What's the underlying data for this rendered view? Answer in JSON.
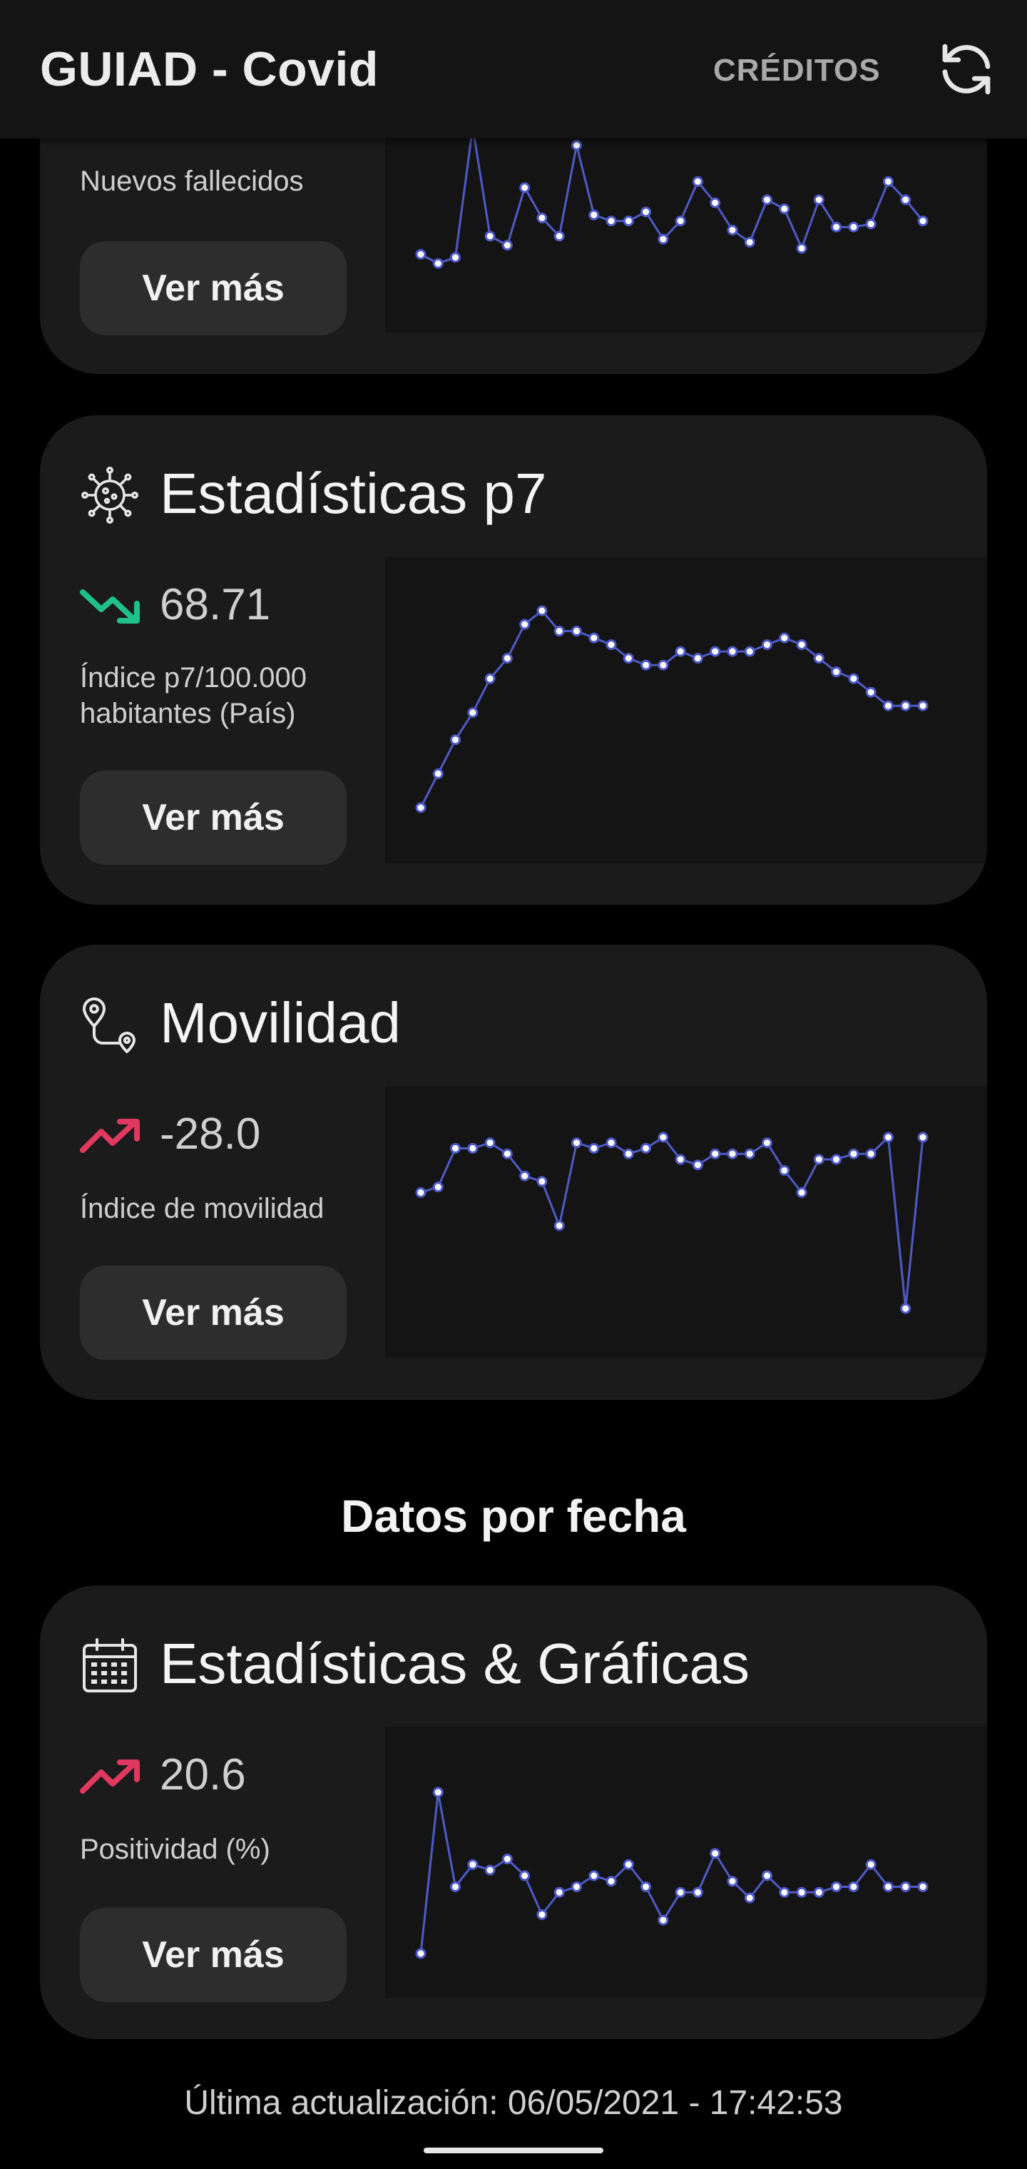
{
  "app_bar": {
    "title": "GUIAD - Covid",
    "credits_label": "CRÉDITOS",
    "refresh_icon": "refresh-icon"
  },
  "colors": {
    "line": "#4e5ac8",
    "point_fill": "#ffffff",
    "trend_down": "#1fc08a",
    "trend_up": "#e0385e"
  },
  "cards": [
    {
      "id": "fallecidos",
      "description": "Nuevos fallecidos",
      "button_label": "Ver más",
      "chart_data": {
        "type": "line",
        "values": [
          6,
          3,
          5,
          48,
          12,
          9,
          28,
          18,
          12,
          42,
          19,
          17,
          17,
          20,
          11,
          17,
          30,
          23,
          14,
          10,
          24,
          21,
          8,
          24,
          15,
          15,
          16,
          30,
          24,
          17
        ],
        "ylim": [
          0,
          48
        ]
      }
    },
    {
      "id": "p7",
      "title": "Estadísticas p7",
      "icon": "virus-icon",
      "trend": "down",
      "value": "68.71",
      "description_line1": "Índice p7/100.000",
      "description_line2": "habitantes (País)",
      "button_label": "Ver más",
      "chart_data": {
        "type": "line",
        "values": [
          48,
          53,
          58,
          62,
          67,
          70,
          75,
          77,
          74,
          74,
          73,
          72,
          70,
          69,
          69,
          71,
          70,
          71,
          71,
          71,
          72,
          73,
          72,
          70,
          68,
          67,
          65,
          63,
          63,
          63
        ],
        "ylim": [
          48,
          77
        ]
      }
    },
    {
      "id": "movilidad",
      "title": "Movilidad",
      "icon": "route-icon",
      "trend": "up",
      "value": "-28.0",
      "description": "Índice de movilidad",
      "button_label": "Ver más",
      "chart_data": {
        "type": "line",
        "values": [
          -35,
          -34,
          -27,
          -27,
          -26,
          -28,
          -32,
          -33,
          -41,
          -26,
          -27,
          -26,
          -28,
          -27,
          -25,
          -29,
          -30,
          -28,
          -28,
          -28,
          -26,
          -31,
          -35,
          -29,
          -29,
          -28,
          -28,
          -25,
          -56,
          -25
        ],
        "ylim": [
          -56,
          -25
        ]
      }
    }
  ],
  "section_heading": "Datos por fecha",
  "date_card": {
    "title": "Estadísticas & Gráficas",
    "icon": "calendar-icon",
    "trend": "up",
    "value": "20.6",
    "description": "Positividad (%)",
    "button_label": "Ver más",
    "chart_data": {
      "type": "line",
      "values": [
        9,
        38,
        21,
        25,
        24,
        26,
        23,
        16,
        20,
        21,
        23,
        22,
        25,
        21,
        15,
        20,
        20,
        27,
        22,
        19,
        23,
        20,
        20,
        20,
        21,
        21,
        25,
        21,
        21,
        21
      ],
      "ylim": [
        9,
        38
      ]
    }
  },
  "footer": {
    "last_update": "Última actualización: 06/05/2021 - 17:42:53"
  }
}
